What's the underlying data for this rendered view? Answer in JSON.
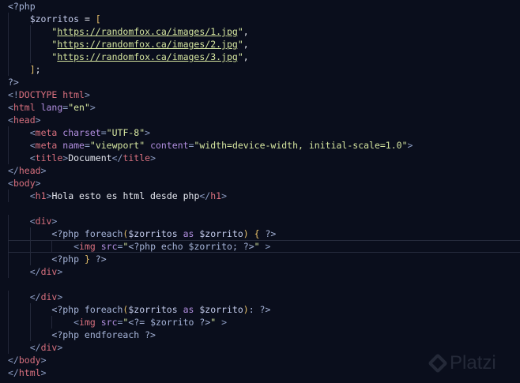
{
  "editor": {
    "current_line": 19,
    "lines": [
      [
        [
          "k",
          "<?php"
        ]
      ],
      [
        [
          "x",
          "    "
        ],
        [
          "v",
          "$zorritos"
        ],
        [
          "x",
          " = "
        ],
        [
          "y",
          "["
        ]
      ],
      [
        [
          "x",
          "        "
        ],
        [
          "s",
          "\""
        ],
        [
          "u",
          "https://randomfox.ca/images/1.jpg"
        ],
        [
          "s",
          "\""
        ],
        [
          "x",
          ","
        ]
      ],
      [
        [
          "x",
          "        "
        ],
        [
          "s",
          "\""
        ],
        [
          "u",
          "https://randomfox.ca/images/2.jpg"
        ],
        [
          "s",
          "\""
        ],
        [
          "x",
          ","
        ]
      ],
      [
        [
          "x",
          "        "
        ],
        [
          "s",
          "\""
        ],
        [
          "u",
          "https://randomfox.ca/images/3.jpg"
        ],
        [
          "s",
          "\""
        ],
        [
          "x",
          ","
        ]
      ],
      [
        [
          "x",
          "    "
        ],
        [
          "y",
          "]"
        ],
        [
          "x",
          ";"
        ]
      ],
      [
        [
          "k",
          "?>"
        ]
      ],
      [
        [
          "p",
          "<!"
        ],
        [
          "t",
          "DOCTYPE html"
        ],
        [
          "p",
          ">"
        ]
      ],
      [
        [
          "p",
          "<"
        ],
        [
          "t",
          "html"
        ],
        [
          "a",
          " lang"
        ],
        [
          "p",
          "="
        ],
        [
          "s",
          "\"en\""
        ],
        [
          "p",
          ">"
        ]
      ],
      [
        [
          "p",
          "<"
        ],
        [
          "t",
          "head"
        ],
        [
          "p",
          ">"
        ]
      ],
      [
        [
          "x",
          "    "
        ],
        [
          "p",
          "<"
        ],
        [
          "t",
          "meta"
        ],
        [
          "a",
          " charset"
        ],
        [
          "p",
          "="
        ],
        [
          "s",
          "\"UTF-8\""
        ],
        [
          "p",
          ">"
        ]
      ],
      [
        [
          "x",
          "    "
        ],
        [
          "p",
          "<"
        ],
        [
          "t",
          "meta"
        ],
        [
          "a",
          " name"
        ],
        [
          "p",
          "="
        ],
        [
          "s",
          "\"viewport\""
        ],
        [
          "a",
          " content"
        ],
        [
          "p",
          "="
        ],
        [
          "s",
          "\"width=device-width, initial-scale=1.0\""
        ],
        [
          "p",
          ">"
        ]
      ],
      [
        [
          "x",
          "    "
        ],
        [
          "p",
          "<"
        ],
        [
          "t",
          "title"
        ],
        [
          "p",
          ">"
        ],
        [
          "x",
          "Document"
        ],
        [
          "p",
          "</"
        ],
        [
          "t",
          "title"
        ],
        [
          "p",
          ">"
        ]
      ],
      [
        [
          "p",
          "</"
        ],
        [
          "t",
          "head"
        ],
        [
          "p",
          ">"
        ]
      ],
      [
        [
          "p",
          "<"
        ],
        [
          "t",
          "body"
        ],
        [
          "p",
          ">"
        ]
      ],
      [
        [
          "x",
          "    "
        ],
        [
          "p",
          "<"
        ],
        [
          "t",
          "h1"
        ],
        [
          "p",
          ">"
        ],
        [
          "x",
          "Hola esto es html desde php"
        ],
        [
          "p",
          "</"
        ],
        [
          "t",
          "h1"
        ],
        [
          "p",
          ">"
        ]
      ],
      [],
      [
        [
          "x",
          "    "
        ],
        [
          "p",
          "<"
        ],
        [
          "t",
          "div"
        ],
        [
          "p",
          ">"
        ]
      ],
      [
        [
          "x",
          "        "
        ],
        [
          "k",
          "<?php foreach"
        ],
        [
          "y",
          "("
        ],
        [
          "v",
          "$zorritos"
        ],
        [
          "as",
          " as "
        ],
        [
          "v",
          "$zorrito"
        ],
        [
          "y",
          ")"
        ],
        [
          "x",
          " "
        ],
        [
          "y",
          "{"
        ],
        [
          "k",
          " ?>"
        ]
      ],
      [
        [
          "x",
          "            "
        ],
        [
          "p",
          "<"
        ],
        [
          "t",
          "img"
        ],
        [
          "a",
          " src"
        ],
        [
          "p",
          "="
        ],
        [
          "s",
          "\""
        ],
        [
          "k",
          "<?php echo $zorrito; ?>"
        ],
        [
          "s",
          "\""
        ],
        [
          "p",
          " >"
        ]
      ],
      [
        [
          "x",
          "        "
        ],
        [
          "k",
          "<?php "
        ],
        [
          "y",
          "}"
        ],
        [
          "k",
          " ?>"
        ]
      ],
      [
        [
          "x",
          "    "
        ],
        [
          "p",
          "</"
        ],
        [
          "t",
          "div"
        ],
        [
          "p",
          ">"
        ]
      ],
      [],
      [
        [
          "x",
          "    "
        ],
        [
          "p",
          "</"
        ],
        [
          "t",
          "div"
        ],
        [
          "p",
          ">"
        ]
      ],
      [
        [
          "x",
          "        "
        ],
        [
          "k",
          "<?php foreach"
        ],
        [
          "y",
          "("
        ],
        [
          "v",
          "$zorritos"
        ],
        [
          "as",
          " as "
        ],
        [
          "v",
          "$zorrito"
        ],
        [
          "y",
          ")"
        ],
        [
          "k",
          ": ?>"
        ]
      ],
      [
        [
          "x",
          "            "
        ],
        [
          "p",
          "<"
        ],
        [
          "t",
          "img"
        ],
        [
          "a",
          " src"
        ],
        [
          "p",
          "="
        ],
        [
          "s",
          "\""
        ],
        [
          "k",
          "<?= $zorrito ?>"
        ],
        [
          "s",
          "\""
        ],
        [
          "p",
          " >"
        ]
      ],
      [
        [
          "x",
          "        "
        ],
        [
          "k",
          "<?php endforeach ?>"
        ]
      ],
      [
        [
          "x",
          "    "
        ],
        [
          "p",
          "</"
        ],
        [
          "t",
          "div"
        ],
        [
          "p",
          ">"
        ]
      ],
      [
        [
          "p",
          "</"
        ],
        [
          "t",
          "body"
        ],
        [
          "p",
          ">"
        ]
      ],
      [
        [
          "p",
          "</"
        ],
        [
          "t",
          "html"
        ],
        [
          "p",
          ">"
        ]
      ]
    ]
  },
  "watermark": {
    "brand": "Platzi"
  }
}
